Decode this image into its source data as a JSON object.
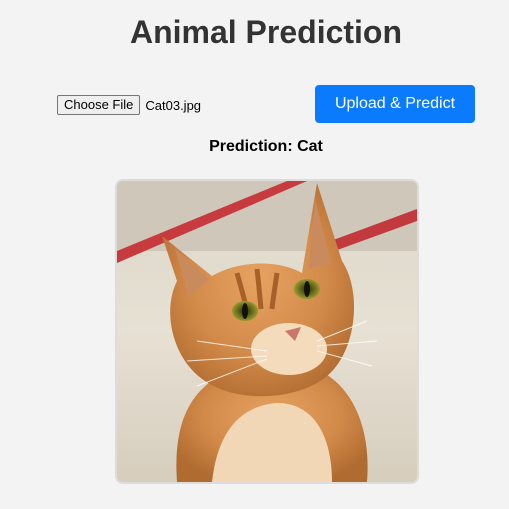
{
  "header": {
    "title": "Animal Prediction"
  },
  "upload": {
    "choose_file_label": "Choose File",
    "file_name": "Cat03.jpg",
    "submit_label": "Upload & Predict"
  },
  "result": {
    "prediction_text": "Prediction: Cat"
  },
  "colors": {
    "background": "#f3f3f3",
    "title": "#333333",
    "button_primary": "#0a7bff",
    "button_text": "#ffffff"
  },
  "icons": {
    "uploaded_image": "cat-photo"
  }
}
